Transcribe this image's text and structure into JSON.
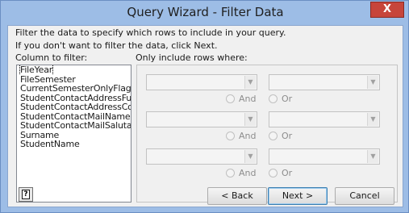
{
  "window": {
    "title": "Query Wizard - Filter Data",
    "close_glyph": "X"
  },
  "instructions": {
    "line1": "Filter the data to specify which rows to include in your query.",
    "line2": "If you don't want to filter the data, click Next."
  },
  "columns": {
    "label": "Column to filter:",
    "items": [
      "FileYear",
      "FileSemester",
      "CurrentSemesterOnlyFlag",
      "StudentContactAddressFul",
      "StudentContactAddressCo",
      "StudentContactMailName",
      "StudentContactMailSalutat",
      "Surname",
      "StudentName"
    ]
  },
  "filter": {
    "label": "Only include rows where:",
    "rows": [
      {
        "operator": "",
        "value": ""
      },
      {
        "operator": "",
        "value": ""
      },
      {
        "operator": "",
        "value": ""
      }
    ],
    "and_label": "And",
    "or_label": "Or"
  },
  "buttons": {
    "help_glyph": "?",
    "back": "< Back",
    "next": "Next >",
    "cancel": "Cancel"
  }
}
